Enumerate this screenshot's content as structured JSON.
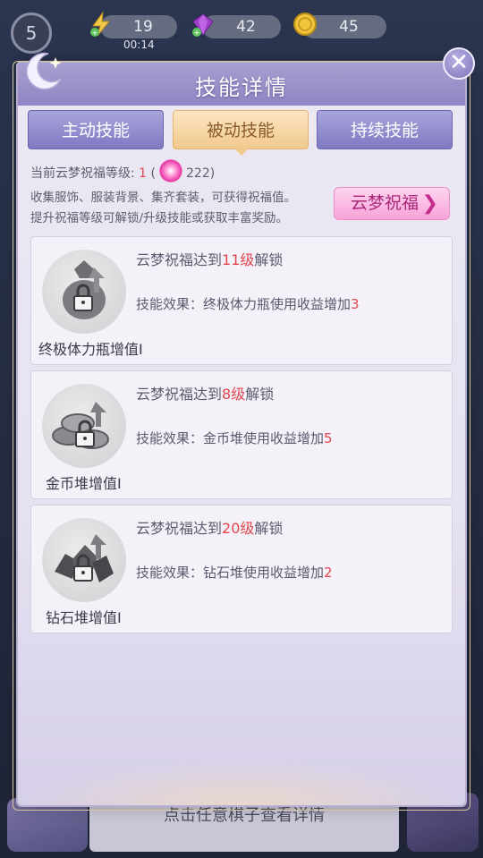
{
  "hud": {
    "level": "5",
    "energy": "19",
    "energy_timer": "00:14",
    "gems": "42",
    "coins": "45"
  },
  "dialog": {
    "title": "技能详情",
    "close_symbol": "✕",
    "tabs": [
      {
        "label": "主动技能",
        "active": false
      },
      {
        "label": "被动技能",
        "active": true
      },
      {
        "label": "持续技能",
        "active": false
      }
    ],
    "blessing": {
      "prefix": "当前云梦祝福等级: ",
      "level": "1",
      "paren_open": " (",
      "points": "222)",
      "desc_line1": "收集服饰、服装背景、集齐套装，可获得祝福值。",
      "desc_line2": "提升祝福等级可解锁/升级技能或获取丰富奖励。",
      "button_label": "云梦祝福",
      "button_chevron": "❯"
    },
    "skills": [
      {
        "name": "终极体力瓶增值I",
        "unlock_prefix": "云梦祝福达到",
        "unlock_level": "11级",
        "unlock_suffix": "解锁",
        "effect_prefix": "技能效果：终极体力瓶使用收益增加",
        "effect_value": "3",
        "icon": "locked-energy-bottle-icon"
      },
      {
        "name": "金币堆增值I",
        "unlock_prefix": "云梦祝福达到",
        "unlock_level": "8级",
        "unlock_suffix": "解锁",
        "effect_prefix": "技能效果：金币堆使用收益增加",
        "effect_value": "5",
        "icon": "locked-coin-pile-icon"
      },
      {
        "name": "钻石堆增值I",
        "unlock_prefix": "云梦祝福达到",
        "unlock_level": "20级",
        "unlock_suffix": "解锁",
        "effect_prefix": "技能效果：钻石堆使用收益增加",
        "effect_value": "2",
        "icon": "locked-diamond-pile-icon"
      }
    ]
  },
  "bottom_hint": "点击任意棋子查看详情",
  "colors": {
    "accent_purple": "#8f86c3",
    "active_tab": "#f1c98d",
    "highlight_red": "#e0474f",
    "bless_pink": "#f7a3d8"
  }
}
